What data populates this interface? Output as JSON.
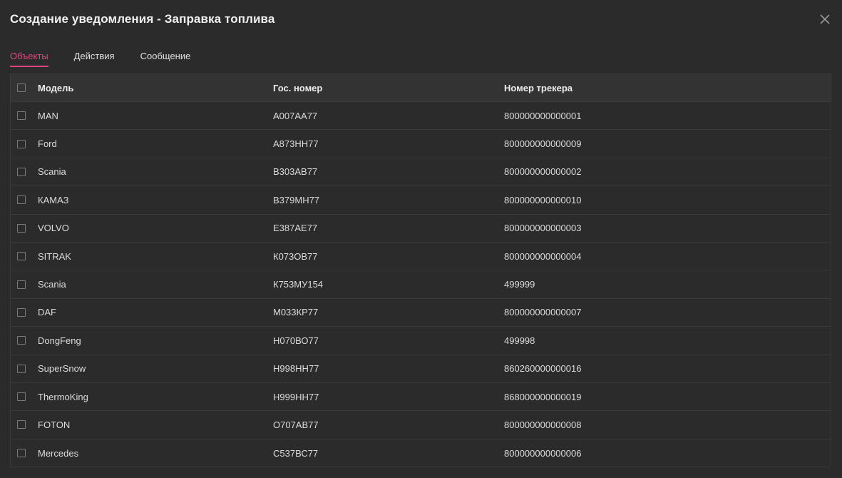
{
  "dialog": {
    "title": "Создание уведомления - Заправка топлива"
  },
  "tabs": [
    {
      "label": "Объекты",
      "active": true
    },
    {
      "label": "Действия",
      "active": false
    },
    {
      "label": "Сообщение",
      "active": false
    }
  ],
  "table": {
    "columns": [
      "Модель",
      "Гос. номер",
      "Номер трекера"
    ],
    "rows": [
      {
        "model": "MAN",
        "plate": "А007АА77",
        "tracker": "800000000000001"
      },
      {
        "model": "Ford",
        "plate": "А873НН77",
        "tracker": "800000000000009"
      },
      {
        "model": "Scania",
        "plate": "В303АВ77",
        "tracker": "800000000000002"
      },
      {
        "model": "КАМАЗ",
        "plate": "В379МН77",
        "tracker": "800000000000010"
      },
      {
        "model": "VOLVO",
        "plate": "Е387АЕ77",
        "tracker": "800000000000003"
      },
      {
        "model": "SITRAK",
        "plate": "К073ОВ77",
        "tracker": "800000000000004"
      },
      {
        "model": "Scania",
        "plate": "К753МУ154",
        "tracker": "499999"
      },
      {
        "model": "DAF",
        "plate": "М033КР77",
        "tracker": "800000000000007"
      },
      {
        "model": "DongFeng",
        "plate": "Н070ВО77",
        "tracker": "499998"
      },
      {
        "model": "SuperSnow",
        "plate": "Н998НН77",
        "tracker": "860260000000016"
      },
      {
        "model": "ThermoKing",
        "plate": "Н999НН77",
        "tracker": "868000000000019"
      },
      {
        "model": "FOTON",
        "plate": "О707АВ77",
        "tracker": "800000000000008"
      },
      {
        "model": "Mercedes",
        "plate": "С537ВС77",
        "tracker": "800000000000006"
      }
    ]
  },
  "icons": {
    "close": "close-icon"
  },
  "colors": {
    "background": "#2b2b2b",
    "header_bg": "#333333",
    "accent": "#e0457f",
    "text": "#dcdcdc",
    "border": "#3a3a3a"
  }
}
